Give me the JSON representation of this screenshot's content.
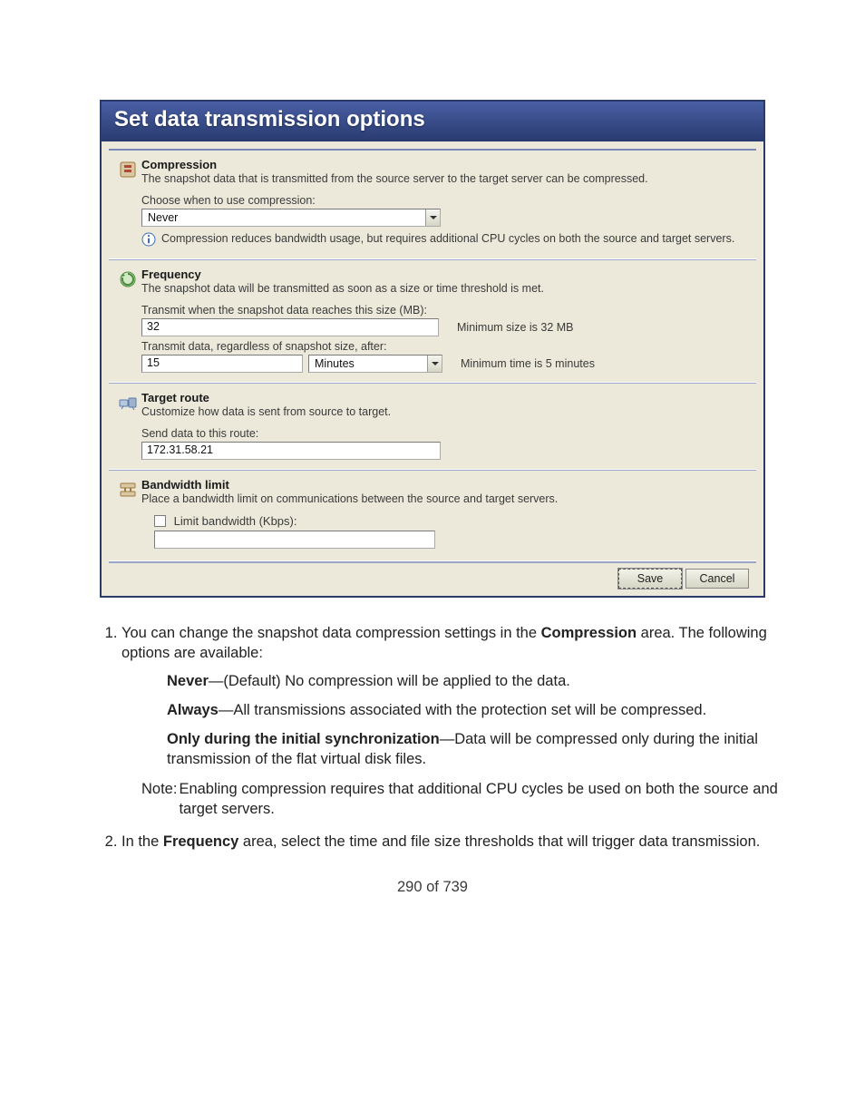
{
  "dialog": {
    "title": "Set data transmission options",
    "compression": {
      "heading": "Compression",
      "desc": "The snapshot data that is transmitted from the source server to the target server can be compressed.",
      "choose_label": "Choose when to use compression:",
      "value": "Never",
      "info": "Compression reduces bandwidth usage, but requires additional CPU cycles on both the source and target servers."
    },
    "frequency": {
      "heading": "Frequency",
      "desc": "The snapshot data will be transmitted as soon as a size or time threshold is met.",
      "size_label": "Transmit when the snapshot data reaches this size (MB):",
      "size_value": "32",
      "size_hint": "Minimum size is 32 MB",
      "time_label": "Transmit data, regardless of snapshot size, after:",
      "time_value": "15",
      "time_unit": "Minutes",
      "time_hint": "Minimum time is 5 minutes"
    },
    "route": {
      "heading": "Target route",
      "desc": "Customize how data is sent from source to target.",
      "label": "Send data to this route:",
      "value": "172.31.58.21"
    },
    "bandwidth": {
      "heading": "Bandwidth limit",
      "desc": "Place a bandwidth limit on communications between the source and target servers.",
      "checkbox_label": "Limit bandwidth (Kbps):",
      "value": ""
    },
    "buttons": {
      "save": "Save",
      "cancel": "Cancel"
    }
  },
  "article": {
    "item1_prefix": "You can change the snapshot data compression settings in the ",
    "item1_bold": "Compression",
    "item1_suffix": " area. The following options are available:",
    "opts": {
      "never_b": "Never",
      "never_t": "—(Default) No compression will be applied to the data.",
      "always_b": "Always",
      "always_t": "—All transmissions associated with the protection set will be compressed.",
      "only_b": "Only during the initial synchronization",
      "only_t": "—Data will be compressed only during the initial transmission of the flat virtual disk files."
    },
    "note_label": "Note:",
    "note_text": "Enabling compression requires that additional CPU cycles be used on both the source and target servers.",
    "item2_prefix": "In the ",
    "item2_bold": "Frequency",
    "item2_suffix": " area, select the time and file size thresholds that will trigger data transmission."
  },
  "page_number": "290 of 739"
}
